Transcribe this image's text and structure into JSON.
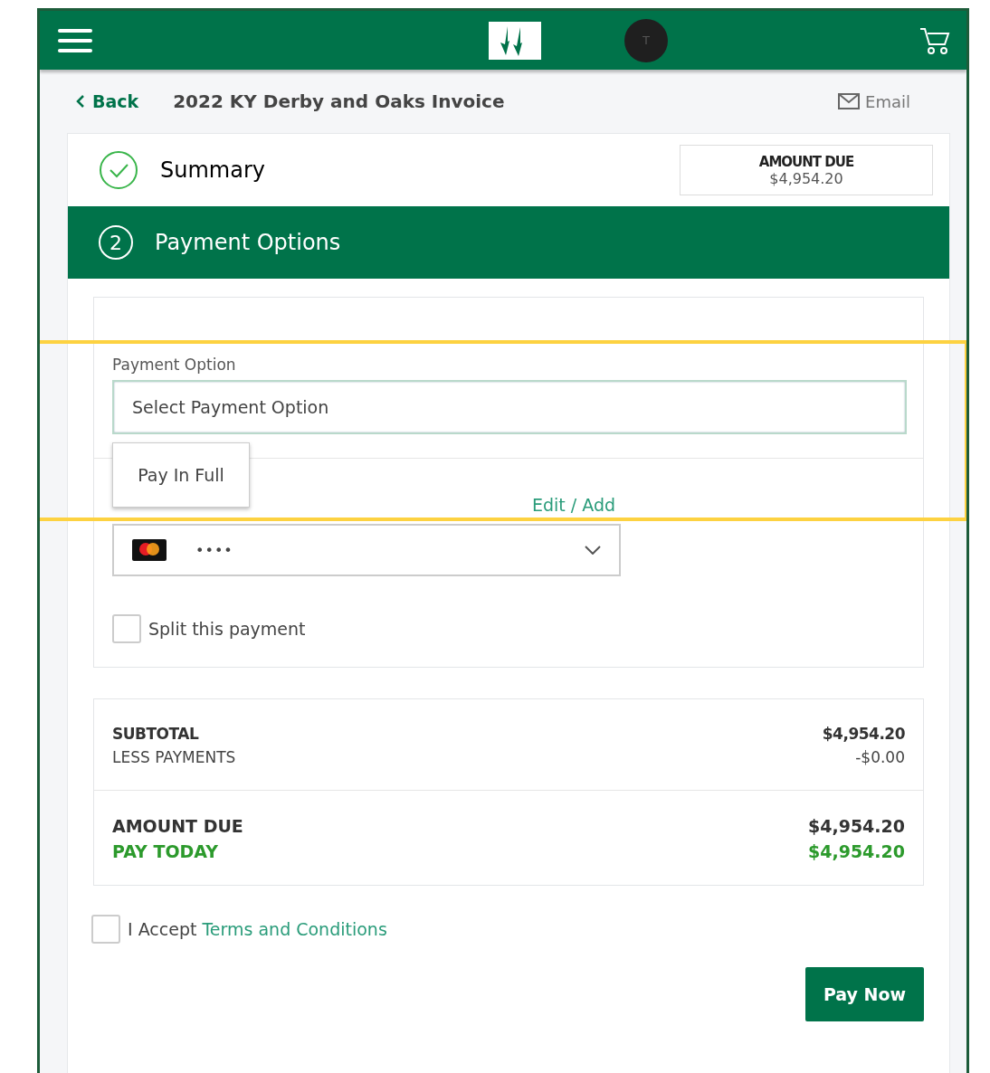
{
  "header": {
    "avatar_initial": "T"
  },
  "title_bar": {
    "back": "Back",
    "title": "2022 KY Derby and Oaks Invoice",
    "email": "Email"
  },
  "steps": [
    {
      "label": "Summary",
      "completed": true,
      "active": false
    },
    {
      "number": "2",
      "label": "Payment Options",
      "completed": false,
      "active": true
    }
  ],
  "amount_due": {
    "label": "AMOUNT DUE",
    "value": "$4,954.20"
  },
  "payment_option": {
    "label": "Payment Option",
    "placeholder": "Select Payment Option",
    "menu": [
      {
        "label": "Pay In Full",
        "selected": false
      }
    ]
  },
  "payment_method": {
    "edit_link": "Edit / Add",
    "card_mask": "••••"
  },
  "split": {
    "label": "Split this payment",
    "checked": false
  },
  "totals": [
    [
      {
        "label": "SUBTOTAL",
        "value": "$4,954.20",
        "kind": "bold"
      },
      {
        "label": "LESS PAYMENTS",
        "value": "-$0.00",
        "kind": "plain"
      }
    ],
    [
      {
        "label": "AMOUNT DUE",
        "value": "$4,954.20",
        "kind": "strong"
      },
      {
        "label": "PAY TODAY",
        "value": "$4,954.20",
        "kind": "accent"
      }
    ]
  ],
  "terms": {
    "text": "I Accept",
    "link": "Terms and Conditions",
    "checked": false
  },
  "pay_button": "Pay Now"
}
